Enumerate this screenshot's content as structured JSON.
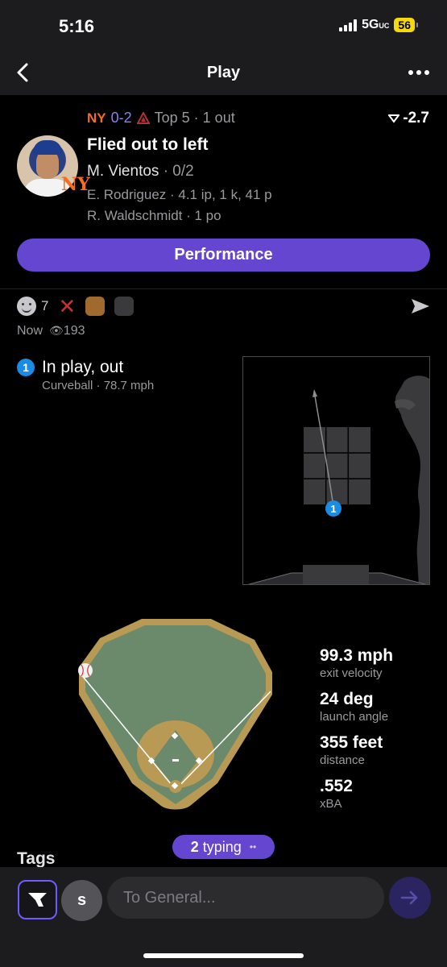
{
  "status": {
    "time": "5:16",
    "network": "5G",
    "network_suffix": "UC",
    "battery": "56"
  },
  "nav": {
    "title": "Play"
  },
  "play": {
    "score": "0-2",
    "team_home_abbr": "NY",
    "inning": "Top 5 · 1 out",
    "wpa": "-2.7",
    "title": "Flied out to left",
    "batter_name": "M. Vientos",
    "batter_line": "· 0/2",
    "pitcher_line": "E. Rodriguez · 4.1 ip, 1 k, 41 p",
    "fielder_line": "R. Waldschmidt · 1 po",
    "performance_label": "Performance"
  },
  "reactions": {
    "count": "7",
    "posted": "Now",
    "views": "193"
  },
  "pitch": {
    "number": "1",
    "result": "In play, out",
    "type": "Curveball · 78.7 mph"
  },
  "stats": [
    {
      "value": "99.3 mph",
      "label": "exit velocity"
    },
    {
      "value": "24 deg",
      "label": "launch angle"
    },
    {
      "value": "355 feet",
      "label": "distance"
    },
    {
      "value": ".552",
      "label": "xBA"
    }
  ],
  "tags_label": "Tags",
  "typing": {
    "count": "2",
    "label": "typing"
  },
  "composer": {
    "user_initial": "s",
    "placeholder": "To General..."
  },
  "colors": {
    "accent": "#6446d1",
    "pitch_marker": "#1b8ce3",
    "field_grass": "#6b8a6b",
    "field_dirt": "#b89a55"
  }
}
